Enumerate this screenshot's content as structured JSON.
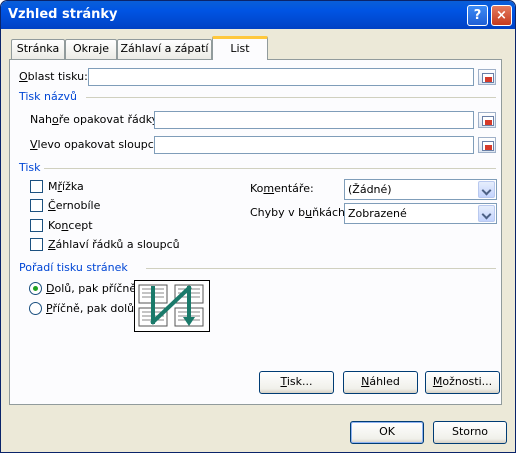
{
  "window": {
    "title": "Vzhled stránky",
    "help_glyph": "?",
    "close_glyph": "×"
  },
  "tabs": [
    {
      "label": "Stránka"
    },
    {
      "label": "Okraje"
    },
    {
      "label": "Záhlaví a zápatí"
    },
    {
      "label": "List",
      "active": true
    }
  ],
  "print_area": {
    "label_u": "O",
    "label_rest": "blast tisku:",
    "value": ""
  },
  "print_titles": {
    "heading": "Tisk názvů",
    "rows_label_a": "Nah",
    "rows_label_u": "o",
    "rows_label_b": "ře opakovat řádky:",
    "rows_value": "",
    "cols_label_u": "V",
    "cols_label_rest": "levo opakovat sloupce:",
    "cols_value": ""
  },
  "print": {
    "heading": "Tisk",
    "gridlines": {
      "a": "M",
      "u": "ř",
      "b": "ížka",
      "checked": false
    },
    "black_white": {
      "u": "Č",
      "b": "ernobíle",
      "checked": false
    },
    "draft": {
      "a": "Ko",
      "u": "n",
      "b": "cept",
      "checked": false
    },
    "headings": {
      "u": "Z",
      "b": "áhlaví řádků a sloupců",
      "checked": false
    },
    "comments_label_a": "Ko",
    "comments_label_u": "m",
    "comments_label_b": "entáře:",
    "comments_value": "(Žádné)",
    "errors_label_a": "Chyby v b",
    "errors_label_u": "u",
    "errors_label_b": "ňkách:",
    "errors_value": "Zobrazené"
  },
  "page_order": {
    "heading": "Pořadí tisku stránek",
    "down_then_over": {
      "u": "D",
      "b": "olů, pak příčně",
      "selected": true
    },
    "over_then_down": {
      "u": "P",
      "b": "říčně, pak dolů",
      "selected": false
    }
  },
  "panel_buttons": {
    "print_u": "T",
    "print_b": "isk...",
    "preview_u": "N",
    "preview_b": "áhled",
    "options_u": "M",
    "options_b": "ožnosti..."
  },
  "footer": {
    "ok": "OK",
    "cancel": "Storno"
  },
  "colors": {
    "title_bar": "#0054e3",
    "group_heading": "#0046d5",
    "accent_tab": "#ffc83c",
    "radio_dot": "#21a121",
    "order_arrow": "#1a7a6a"
  }
}
